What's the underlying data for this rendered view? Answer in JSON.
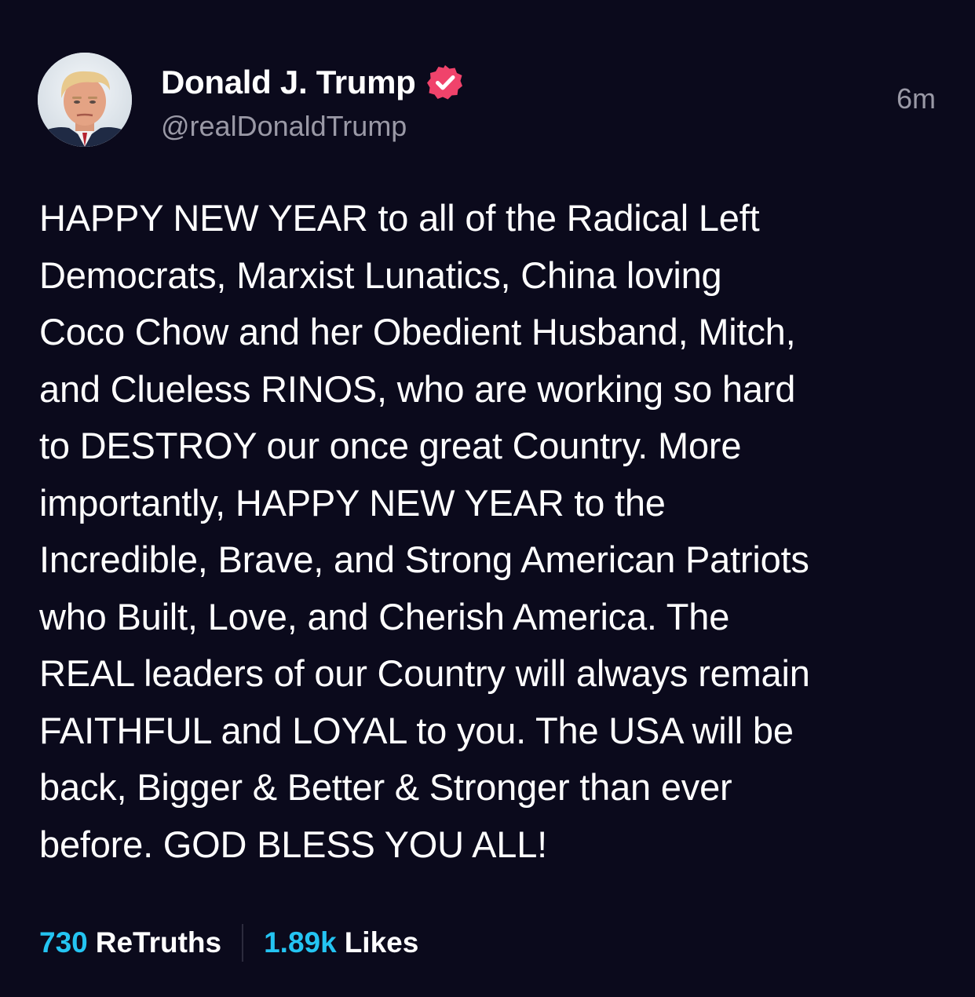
{
  "author": {
    "display_name": "Donald J. Trump",
    "handle": "@realDonaldTrump",
    "verified_badge": "verified-badge-icon",
    "badge_color": "#f0436b"
  },
  "timestamp": "6m",
  "post": {
    "lines": [
      "HAPPY NEW YEAR to all of the Radical Left",
      "Democrats, Marxist Lunatics, China loving",
      "Coco Chow and her Obedient Husband, Mitch,",
      "and Clueless RINOS, who are working so hard",
      "to DESTROY our once great Country. More",
      "importantly, HAPPY NEW YEAR to the",
      "Incredible, Brave, and Strong American Patriots",
      "who Built, Love, and Cherish America. The",
      "REAL leaders of our Country will always remain",
      "FAITHFUL and LOYAL to you. The USA will be",
      "back, Bigger & Better & Stronger than ever",
      "before. GOD BLESS YOU ALL!"
    ]
  },
  "stats": {
    "retruths_count": "730",
    "retruths_label": "ReTruths",
    "likes_count": "1.89k",
    "likes_label": "Likes"
  },
  "colors": {
    "background": "#0b0a1c",
    "accent": "#24c4f2",
    "muted": "#9a99a6"
  }
}
